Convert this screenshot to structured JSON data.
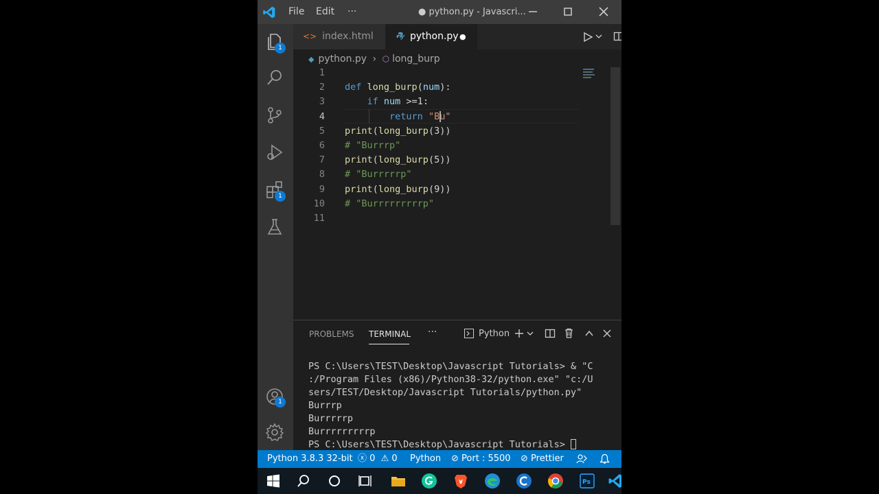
{
  "titlebar": {
    "menu": [
      "File",
      "Edit",
      "···"
    ],
    "title": "● python.py - Javascri..."
  },
  "activity": {
    "explorer_badge": "1",
    "extensions_badge": "1",
    "accounts_badge": "1"
  },
  "tabs": [
    {
      "label": "index.html",
      "icon": "html-icon"
    },
    {
      "label": "python.py",
      "icon": "python-icon",
      "modified": "●"
    }
  ],
  "breadcrumb": {
    "file": "python.py",
    "symbol": "long_burp"
  },
  "editor": {
    "current_line": 4,
    "lines": [
      {
        "n": "1",
        "tokens": []
      },
      {
        "n": "2",
        "tokens": [
          {
            "t": "def",
            "c": "kw"
          },
          {
            "t": " ",
            "c": "pl"
          },
          {
            "t": "long_burp",
            "c": "fn"
          },
          {
            "t": "(",
            "c": "pl"
          },
          {
            "t": "num",
            "c": "var"
          },
          {
            "t": "):",
            "c": "pl"
          }
        ]
      },
      {
        "n": "3",
        "tokens": [
          {
            "t": "    ",
            "c": "pl"
          },
          {
            "t": "if",
            "c": "kw"
          },
          {
            "t": " ",
            "c": "pl"
          },
          {
            "t": "num",
            "c": "var"
          },
          {
            "t": " >=",
            "c": "op"
          },
          {
            "t": "1",
            "c": "pl"
          },
          {
            "t": ":",
            "c": "pl"
          }
        ]
      },
      {
        "n": "4",
        "tokens": [
          {
            "t": "        ",
            "c": "pl"
          },
          {
            "t": "return",
            "c": "kw"
          },
          {
            "t": " ",
            "c": "pl"
          },
          {
            "t": "\"Bu\"",
            "c": "str"
          }
        ]
      },
      {
        "n": "5",
        "tokens": [
          {
            "t": "print",
            "c": "fn"
          },
          {
            "t": "(",
            "c": "pl"
          },
          {
            "t": "long_burp",
            "c": "fn"
          },
          {
            "t": "(3))",
            "c": "pl"
          }
        ]
      },
      {
        "n": "6",
        "tokens": [
          {
            "t": "# \"Burrrp\"",
            "c": "cm"
          }
        ]
      },
      {
        "n": "7",
        "tokens": [
          {
            "t": "print",
            "c": "fn"
          },
          {
            "t": "(",
            "c": "pl"
          },
          {
            "t": "long_burp",
            "c": "fn"
          },
          {
            "t": "(5))",
            "c": "pl"
          }
        ]
      },
      {
        "n": "8",
        "tokens": [
          {
            "t": "# \"Burrrrrp\"",
            "c": "cm"
          }
        ]
      },
      {
        "n": "9",
        "tokens": [
          {
            "t": "print",
            "c": "fn"
          },
          {
            "t": "(",
            "c": "pl"
          },
          {
            "t": "long_burp",
            "c": "fn"
          },
          {
            "t": "(9))",
            "c": "pl"
          }
        ]
      },
      {
        "n": "10",
        "tokens": [
          {
            "t": "# \"Burrrrrrrrrp\"",
            "c": "cm"
          }
        ]
      },
      {
        "n": "11",
        "tokens": []
      }
    ]
  },
  "panel": {
    "tabs": [
      "PROBLEMS",
      "TERMINAL",
      "···"
    ],
    "active_tab": "TERMINAL",
    "terminal_name": "Python",
    "output": [
      "PS C:\\Users\\TEST\\Desktop\\Javascript Tutorials> & \"C",
      ":/Program Files (x86)/Python38-32/python.exe\" \"c:/U",
      "sers/TEST/Desktop/Javascript Tutorials/python.py\"",
      "Burrrp",
      "Burrrrrp",
      "Burrrrrrrrrp",
      "PS C:\\Users\\TEST\\Desktop\\Javascript Tutorials> "
    ]
  },
  "statusbar": {
    "interpreter": "Python 3.8.3 32-bit",
    "errors": "0",
    "warnings": "0",
    "language": "Python",
    "port": "Port : 5500",
    "prettier": "Prettier"
  },
  "taskbar": {
    "icons": [
      "windows-start-icon",
      "search-icon",
      "cortana-icon",
      "task-view-icon",
      "file-explorer-icon",
      "grammarly-icon",
      "brave-icon",
      "edge-icon",
      "ccleaner-icon",
      "chrome-icon",
      "photoshop-icon",
      "vscode-icon"
    ]
  },
  "colors": {
    "accent": "#007acc",
    "editor_bg": "#1e1e1e",
    "keyword": "#569cd6",
    "function": "#dcdcaa",
    "string": "#ce9178",
    "comment": "#6a9955"
  }
}
